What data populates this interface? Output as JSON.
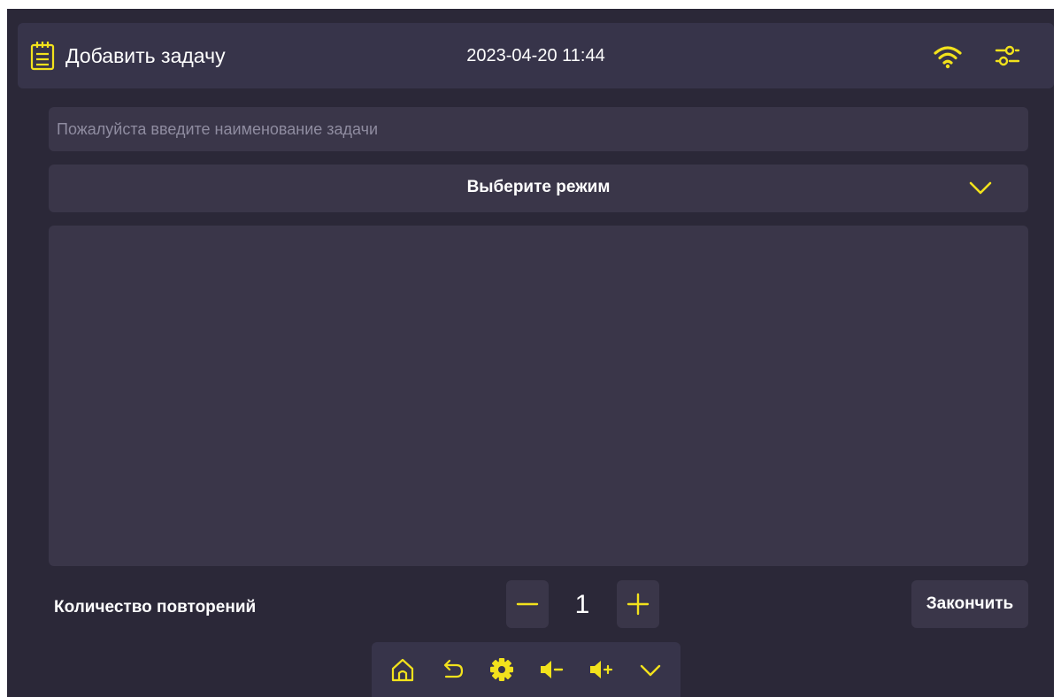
{
  "header": {
    "title": "Добавить задачу",
    "datetime": "2023-04-20 11:44",
    "icons": [
      "notepad-icon",
      "wifi-icon",
      "settings-sliders-icon"
    ]
  },
  "task_name": {
    "value": "",
    "placeholder": "Пожалуйста введите наименование задачи"
  },
  "mode_select": {
    "label": "Выберите режим"
  },
  "repetitions": {
    "label": "Количество повторений",
    "count": "1"
  },
  "finish_button": {
    "label": "Закончить"
  },
  "bottom_nav": {
    "icons": [
      "home-icon",
      "back-icon",
      "gear-icon",
      "volume-down-icon",
      "volume-up-icon",
      "chevron-down-icon"
    ]
  },
  "colors": {
    "accent": "#f2e21c",
    "background": "#2b2838",
    "panel": "#3a3649",
    "header": "#37344a",
    "text": "#ffffff",
    "placeholder": "#8f8ca0"
  }
}
